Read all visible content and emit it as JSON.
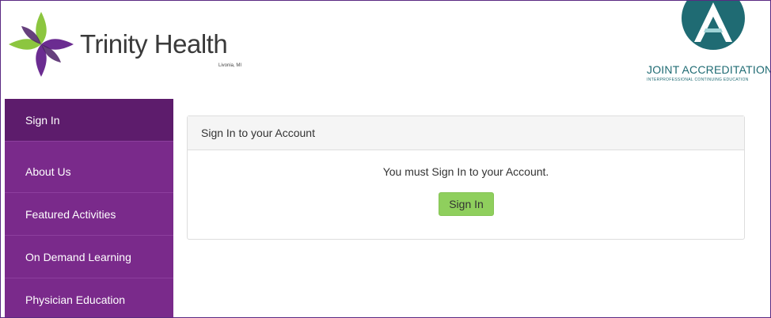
{
  "header": {
    "brand_name": "Trinity Health",
    "brand_location": "Livonia, MI",
    "accreditation_title": "JOINT ACCREDITATION",
    "accreditation_subtitle": "INTERPROFESSIONAL CONTINUING EDUCATION"
  },
  "sidebar": {
    "items": [
      {
        "label": "Sign In"
      },
      {
        "label": "About Us"
      },
      {
        "label": "Featured Activities"
      },
      {
        "label": "On Demand Learning"
      },
      {
        "label": "Physician Education"
      }
    ]
  },
  "main": {
    "panel_title": "Sign In to your Account",
    "message": "You must Sign In to your Account.",
    "signin_button": "Sign In"
  },
  "colors": {
    "sidebar_bg": "#7a2a8b",
    "sidebar_active": "#5d1c6c",
    "button_green": "#8fcf5d",
    "accreditation_teal": "#1f6b73"
  },
  "icons": {
    "brand_logo": "trinity-cross-logo",
    "accreditation_logo": "joint-accreditation-logo"
  }
}
